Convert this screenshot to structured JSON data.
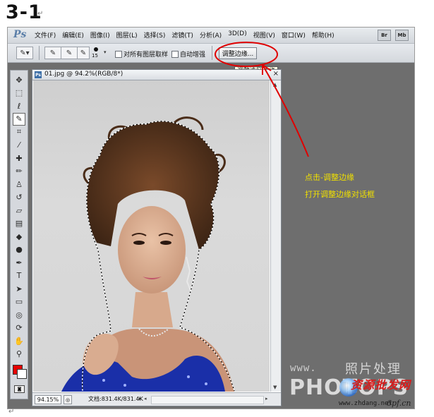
{
  "doc": {
    "heading": "3-1",
    "para_mark": "↵",
    "para_mark_bottom": "↵"
  },
  "menubar": {
    "logo": "Ps",
    "items": [
      "文件(F)",
      "编辑(E)",
      "图像(I)",
      "图层(L)",
      "选择(S)",
      "滤镜(T)",
      "分析(A)",
      "3D(D)",
      "视图(V)",
      "窗口(W)",
      "帮助(H)"
    ],
    "right_buttons": [
      "Br",
      "Mb"
    ]
  },
  "options": {
    "brush_size": "15",
    "sample_all_layers": "对所有图层取样",
    "auto_enhance": "自动增强",
    "refine_edge_button": "调整边缘...",
    "tooltip": "调整选区边缘"
  },
  "document": {
    "ps_badge": "Ps",
    "title": "01.jpg @ 94.2%(RGB/8*)",
    "close": "×",
    "zoom": "94.15%",
    "status_text": "文档:831.4K/831.4K"
  },
  "annotation": {
    "line1": "点击-调整边缘",
    "line2": "打开调整边缘对话框",
    "color": "#f0e000",
    "arrow_color": "#e00000"
  },
  "watermark": {
    "www": "www.",
    "cn_title": "照片处理网",
    "brand": "PHOTOPS",
    "red_text": "资源批发网",
    "url": "www.zhdang.net",
    "url2": "6pf.cn"
  },
  "toolbox": {
    "tools": [
      {
        "name": "move-tool-icon",
        "glyph": "✥"
      },
      {
        "name": "marquee-tool-icon",
        "glyph": "⬚"
      },
      {
        "name": "lasso-tool-icon",
        "glyph": "ℓ"
      },
      {
        "name": "quick-selection-tool-icon",
        "glyph": "✎"
      },
      {
        "name": "crop-tool-icon",
        "glyph": "⌗"
      },
      {
        "name": "eyedropper-tool-icon",
        "glyph": "⁄"
      },
      {
        "name": "healing-brush-tool-icon",
        "glyph": "✚"
      },
      {
        "name": "brush-tool-icon",
        "glyph": "✏"
      },
      {
        "name": "clone-stamp-tool-icon",
        "glyph": "♙"
      },
      {
        "name": "history-brush-tool-icon",
        "glyph": "↺"
      },
      {
        "name": "eraser-tool-icon",
        "glyph": "▱"
      },
      {
        "name": "gradient-tool-icon",
        "glyph": "▤"
      },
      {
        "name": "blur-tool-icon",
        "glyph": "◆"
      },
      {
        "name": "dodge-tool-icon",
        "glyph": "●"
      },
      {
        "name": "pen-tool-icon",
        "glyph": "✒"
      },
      {
        "name": "type-tool-icon",
        "glyph": "T"
      },
      {
        "name": "path-selection-tool-icon",
        "glyph": "➤"
      },
      {
        "name": "shape-tool-icon",
        "glyph": "▭"
      },
      {
        "name": "3d-rotate-tool-icon",
        "glyph": "◎"
      },
      {
        "name": "3d-orbit-tool-icon",
        "glyph": "⟳"
      },
      {
        "name": "hand-tool-icon",
        "glyph": "✋"
      },
      {
        "name": "zoom-tool-icon",
        "glyph": "⚲"
      }
    ],
    "active_index": 3,
    "foreground_color": "#e60000",
    "background_color": "#ffffff"
  }
}
